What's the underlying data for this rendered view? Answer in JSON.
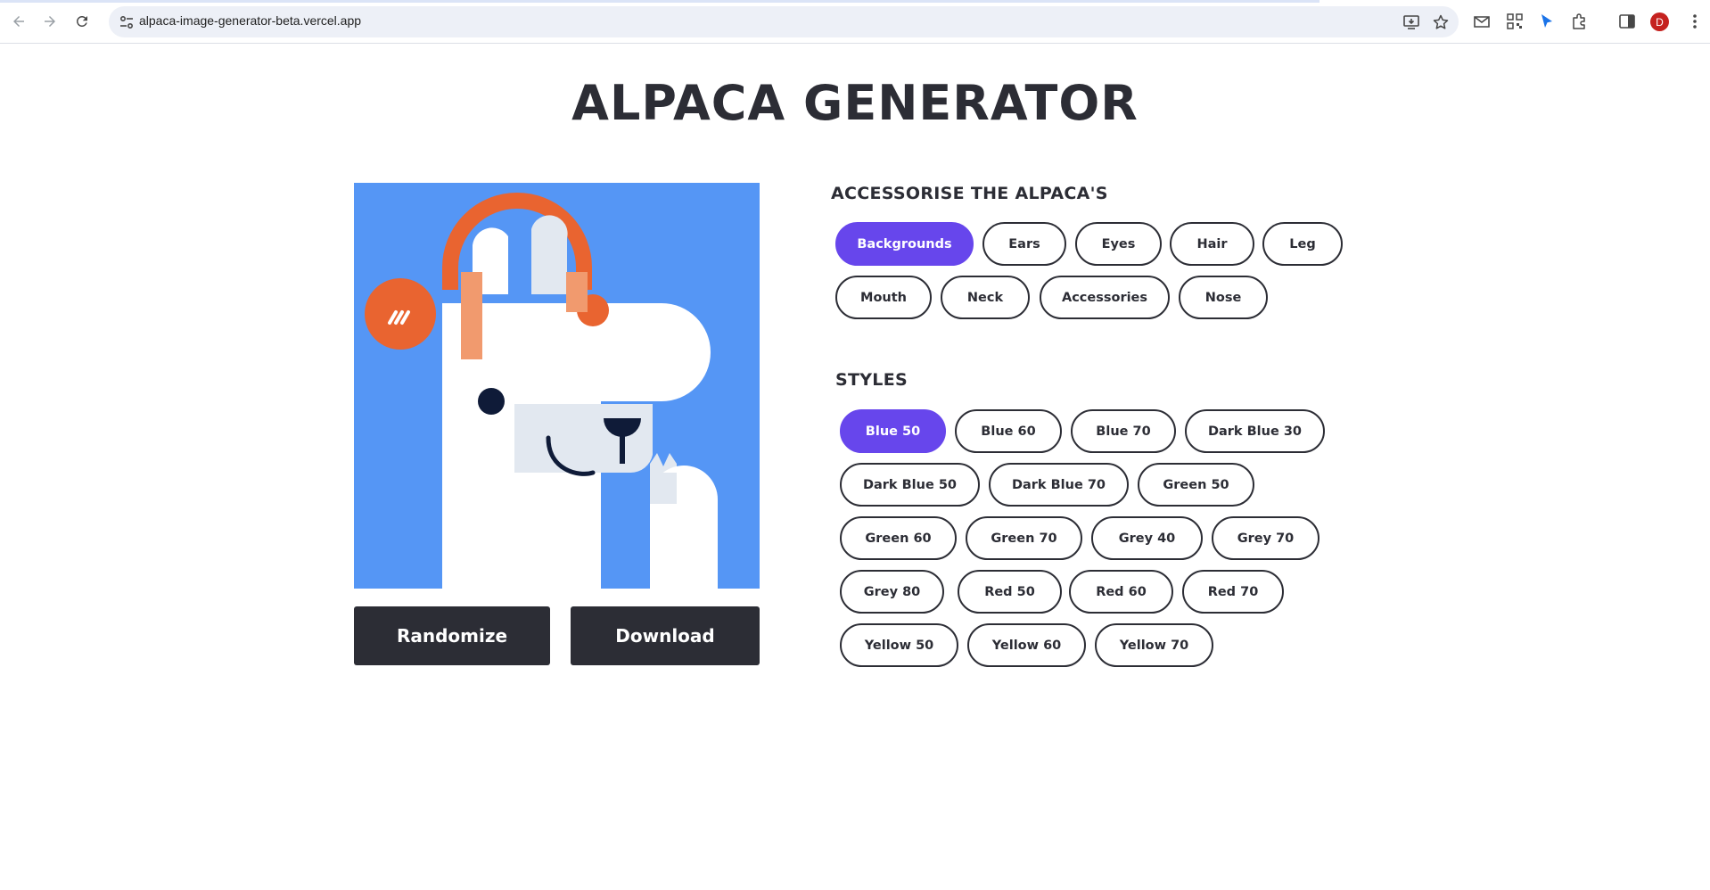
{
  "browser": {
    "url": "alpaca-image-generator-beta.vercel.app",
    "profile_initial": "D"
  },
  "page": {
    "title": "ALPACA GENERATOR"
  },
  "actions": {
    "randomize_label": "Randomize",
    "download_label": "Download"
  },
  "accessorise": {
    "title": "ACCESSORISE THE ALPACA'S",
    "selected": "Backgrounds",
    "items": [
      "Backgrounds",
      "Ears",
      "Eyes",
      "Hair",
      "Leg",
      "Mouth",
      "Neck",
      "Accessories",
      "Nose"
    ]
  },
  "styles": {
    "title": "STYLES",
    "selected": "Blue 50",
    "items": [
      "Blue 50",
      "Blue 60",
      "Blue 70",
      "Dark Blue 30",
      "Dark Blue 50",
      "Dark Blue 70",
      "Green 50",
      "Green 60",
      "Green 70",
      "Grey 40",
      "Grey 70",
      "Grey 80",
      "Red 50",
      "Red 60",
      "Red 70",
      "Yellow 50",
      "Yellow 60",
      "Yellow 70"
    ]
  },
  "colors": {
    "accent": "#6746ec",
    "dark": "#2c2d35",
    "alpaca_background": "#5596f5",
    "headphones": "#e96430",
    "headphone_pad": "#f19a6e"
  }
}
